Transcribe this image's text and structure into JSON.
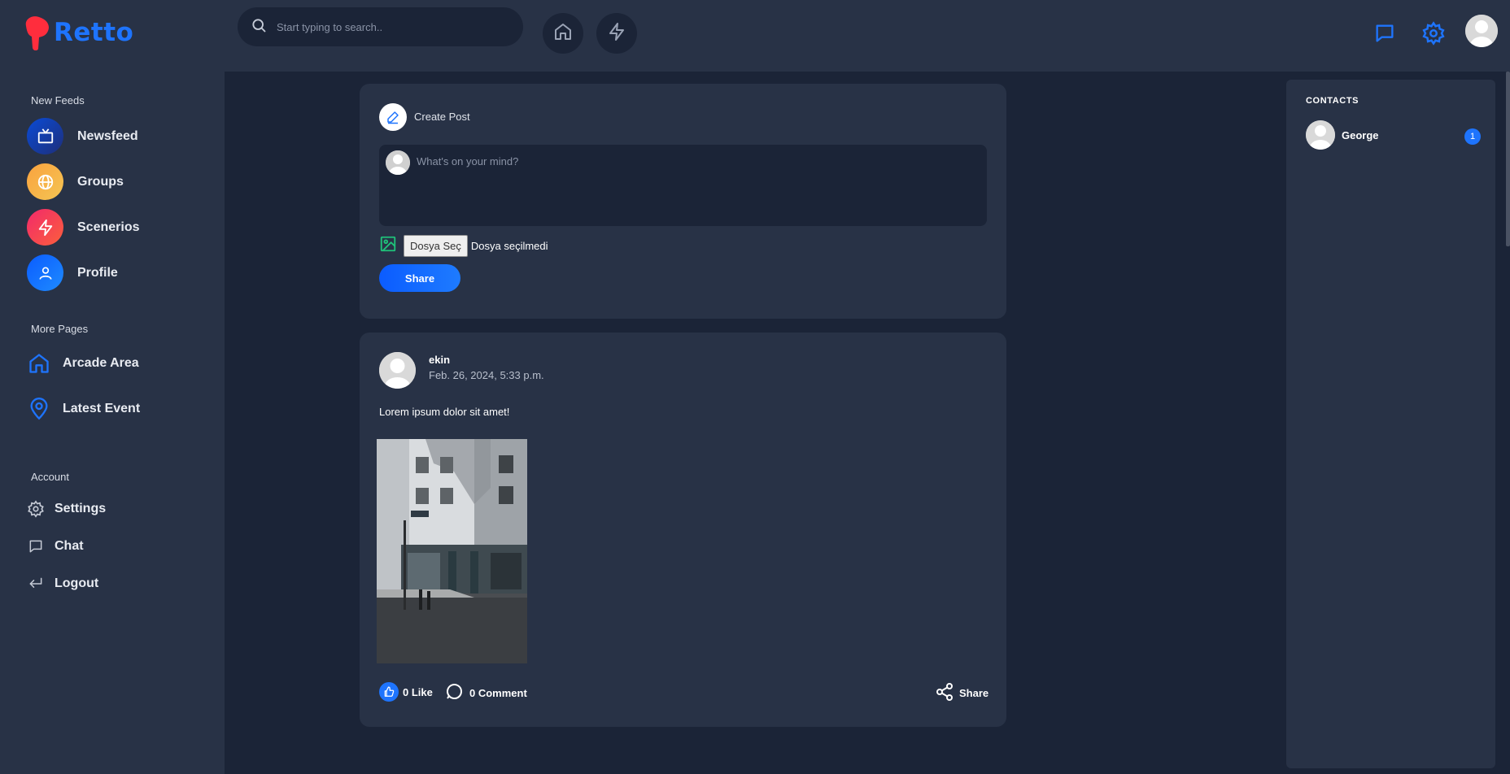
{
  "brand": {
    "name": "Retto",
    "color": "#1e74fd"
  },
  "search": {
    "placeholder": "Start typing to search.."
  },
  "header": {
    "buttons": [
      {
        "icon": "home-icon"
      },
      {
        "icon": "zap-icon"
      }
    ],
    "right_icons": [
      "message-square-icon",
      "settings-icon"
    ]
  },
  "sidebar": {
    "feeds_title": "New Feeds",
    "feeds": [
      {
        "label": "Newsfeed",
        "icon": "tv-icon"
      },
      {
        "label": "Groups",
        "icon": "globe-icon"
      },
      {
        "label": "Scenerios",
        "icon": "zap-icon"
      },
      {
        "label": "Profile",
        "icon": "user-icon"
      }
    ],
    "more_title": "More Pages",
    "more": [
      {
        "label": "Arcade Area",
        "icon": "home-icon"
      },
      {
        "label": "Latest Event",
        "icon": "map-pin-icon"
      }
    ],
    "account_title": "Account",
    "account": [
      {
        "label": "Settings",
        "icon": "settings-icon"
      },
      {
        "label": "Chat",
        "icon": "message-square-icon"
      },
      {
        "label": "Logout",
        "icon": "logout-icon"
      }
    ]
  },
  "create_post": {
    "title": "Create Post",
    "placeholder": "What's on your mind?",
    "file_button": "Dosya Seç",
    "file_status": "Dosya seçilmedi",
    "share_label": "Share"
  },
  "post": {
    "author": "ekin",
    "date": "Feb. 26, 2024, 5:33 p.m.",
    "text": "Lorem ipsum dolor sit amet!",
    "like_label": "0 Like",
    "comment_label": "0 Comment",
    "share_label": "Share"
  },
  "contacts": {
    "title": "CONTACTS",
    "items": [
      {
        "name": "George",
        "badge": "1"
      }
    ]
  }
}
